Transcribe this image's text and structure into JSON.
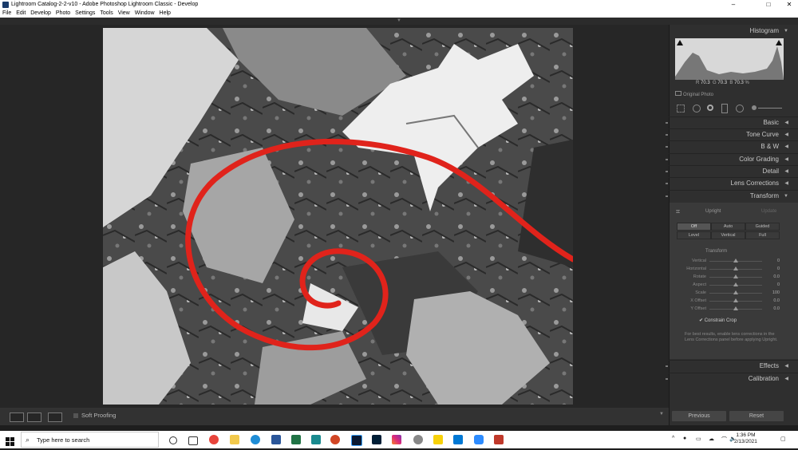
{
  "window": {
    "title": "Lightroom Catalog-2-2-v10 - Adobe Photoshop Lightroom Classic - Develop",
    "minimize": "–",
    "maximize": "□",
    "close": "✕"
  },
  "menu": [
    "File",
    "Edit",
    "Develop",
    "Photo",
    "Settings",
    "Tools",
    "View",
    "Window",
    "Help"
  ],
  "histogram": {
    "header": "Histogram",
    "r_label": "R",
    "r_value": "70.3",
    "g_label": "G",
    "g_value": "70.3",
    "b_label": "B",
    "b_value": "70.3",
    "pct": "%",
    "original_photo": "Original Photo"
  },
  "panels": {
    "basic": "Basic",
    "tone_curve": "Tone Curve",
    "bw": "B & W",
    "color_grading": "Color Grading",
    "detail": "Detail",
    "lens_corrections": "Lens Corrections",
    "transform": "Transform",
    "effects": "Effects",
    "calibration": "Calibration"
  },
  "transform": {
    "upright_label": "Upright",
    "update_label": "Update",
    "modes": [
      "Off",
      "Auto",
      "Guided",
      "Level",
      "Vertical",
      "Full"
    ],
    "section_title": "Transform",
    "sliders": [
      {
        "name": "Vertical",
        "value": "0"
      },
      {
        "name": "Horizontal",
        "value": "0"
      },
      {
        "name": "Rotate",
        "value": "0.0"
      },
      {
        "name": "Aspect",
        "value": "0"
      },
      {
        "name": "Scale",
        "value": "100"
      },
      {
        "name": "X Offset",
        "value": "0.0"
      },
      {
        "name": "Y Offset",
        "value": "0.0"
      }
    ],
    "constrain_crop": "Constrain Crop",
    "note": "For best results, enable lens corrections in the Lens Corrections panel before applying Upright."
  },
  "buttons": {
    "previous": "Previous",
    "reset": "Reset"
  },
  "toolbar": {
    "soft_proofing": "Soft Proofing"
  },
  "taskbar": {
    "search_placeholder": "Type here to search",
    "time": "1:36 PM",
    "date": "2/13/2021"
  },
  "colors": {
    "accent_red": "#e0231b",
    "panel_bg": "#2f2f2f"
  }
}
